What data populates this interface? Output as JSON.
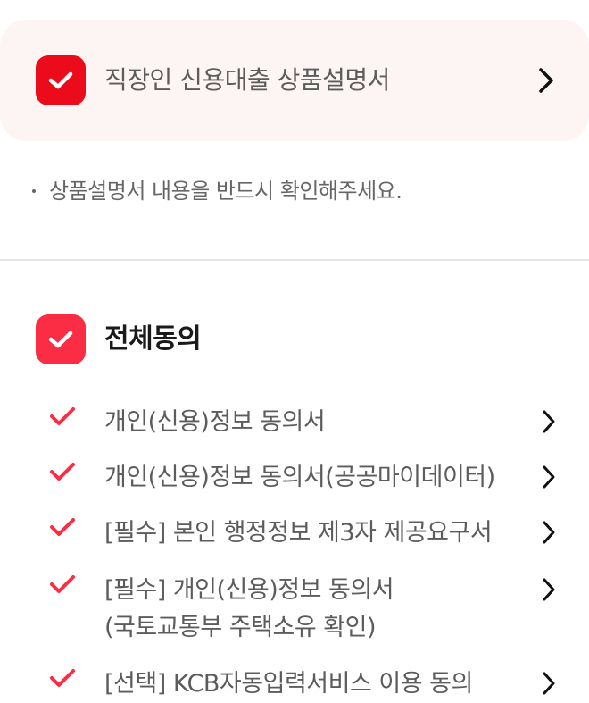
{
  "product": {
    "title": "직장인 신용대출 상품설명서",
    "checked": true
  },
  "notice": {
    "text": "상품설명서 내용을 반드시 확인해주세요."
  },
  "agreement": {
    "all_label": "전체동의",
    "items": [
      {
        "lines": [
          "개인(신용)정보 동의서"
        ],
        "checked": true
      },
      {
        "lines": [
          "개인(신용)정보 동의서(공공마이데이터)"
        ],
        "checked": true
      },
      {
        "lines": [
          "[필수] 본인 행정정보 제3자 제공요구서"
        ],
        "checked": true
      },
      {
        "lines": [
          "[필수] 개인(신용)정보 동의서",
          "(국토교통부 주택소유 확인)"
        ],
        "checked": true
      },
      {
        "lines": [
          "[선택] KCB자동입력서비스 이용 동의"
        ],
        "checked": true
      }
    ]
  },
  "colors": {
    "primary_red": "#eb0b1b",
    "check_red": "#fb2d45",
    "card_bg": "#fdf4f4"
  },
  "icons": {
    "check_box": "check-box-icon",
    "check_mark": "check-mark-icon",
    "chevron": "chevron-right-icon"
  }
}
